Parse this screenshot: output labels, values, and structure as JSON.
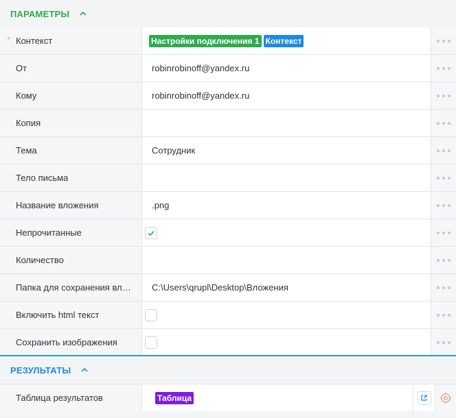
{
  "parameters": {
    "title": "ПАРАМЕТРЫ",
    "color": "#2eaa4f",
    "rows": [
      {
        "label": "Контекст",
        "required": "*",
        "badges": [
          {
            "text": "Настройки подключения 1",
            "color": "#2eaa4f"
          },
          {
            "text": "Контекст",
            "color": "#1e88e5"
          }
        ]
      },
      {
        "label": "От",
        "value": "robinrobinoff@yandex.ru"
      },
      {
        "label": "Кому",
        "value": "robinrobinoff@yandex.ru"
      },
      {
        "label": "Копия",
        "value": ""
      },
      {
        "label": "Тема",
        "value": "Сотрудник"
      },
      {
        "label": "Тело письма",
        "value": ""
      },
      {
        "label": "Название вложения",
        "value": ".png"
      },
      {
        "label": "Непрочитанные",
        "checkbox": true,
        "checked": true
      },
      {
        "label": "Количество",
        "value": ""
      },
      {
        "label": "Папка для сохранения влож...",
        "value": "C:\\Users\\qrupl\\Desktop\\Вложения"
      },
      {
        "label": "Включить html текст",
        "checkbox": true,
        "checked": false
      },
      {
        "label": "Сохранить изображения",
        "checkbox": true,
        "checked": false
      }
    ]
  },
  "results": {
    "title": "РЕЗУЛЬТАТЫ",
    "color": "#1e88e5",
    "row": {
      "label": "Таблица результатов",
      "badge": {
        "text": "Таблица",
        "color": "#7b1fe0"
      }
    }
  }
}
